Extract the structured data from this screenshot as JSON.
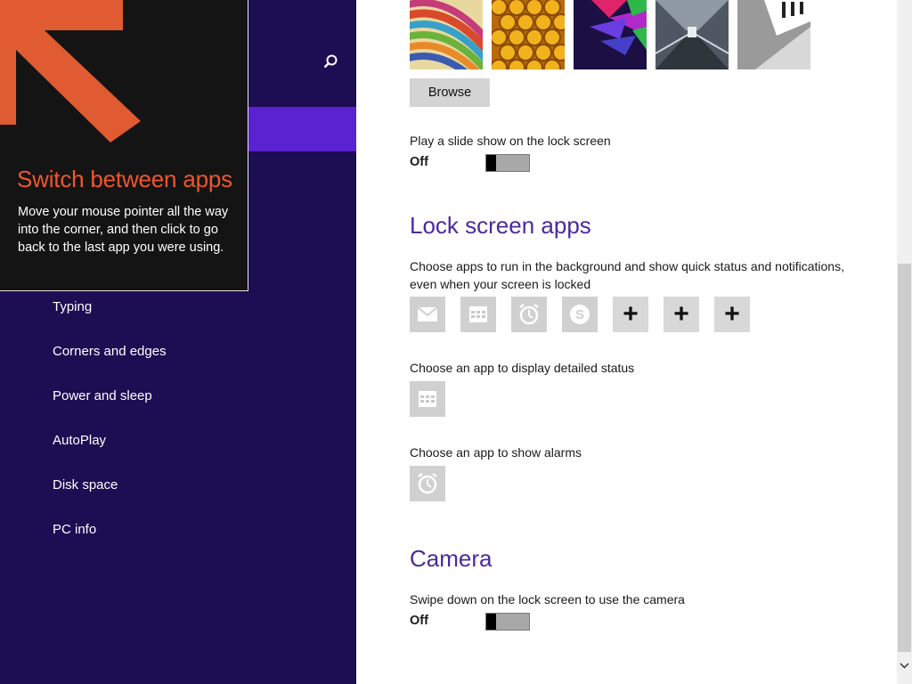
{
  "tip": {
    "title": "Switch between apps",
    "body": "Move your mouse pointer all the way into the corner, and then click to go back to the last app you were using."
  },
  "nav": {
    "search_icon": "search-icon",
    "items": [
      {
        "label": "Typing"
      },
      {
        "label": "Corners and edges"
      },
      {
        "label": "Power and sleep"
      },
      {
        "label": "AutoPlay"
      },
      {
        "label": "Disk space"
      },
      {
        "label": "PC info"
      }
    ]
  },
  "lock_screen": {
    "browse_label": "Browse",
    "slideshow_label": "Play a slide show on the lock screen",
    "slideshow_state": "Off"
  },
  "lock_apps": {
    "heading": "Lock screen apps",
    "description": "Choose apps to run in the background and show quick status and notifications, even when your screen is locked",
    "slots": [
      {
        "icon": "mail-icon"
      },
      {
        "icon": "calendar-icon"
      },
      {
        "icon": "alarm-icon"
      },
      {
        "icon": "skype-icon"
      },
      {
        "icon": "plus",
        "glyph": "+"
      },
      {
        "icon": "plus",
        "glyph": "+"
      },
      {
        "icon": "plus",
        "glyph": "+"
      }
    ],
    "detailed_status_label": "Choose an app to display detailed status",
    "alarms_label": "Choose an app to show alarms"
  },
  "camera": {
    "heading": "Camera",
    "swipe_label": "Swipe down on the lock screen to use the camera",
    "swipe_state": "Off"
  },
  "colors": {
    "nav_bg": "#1d0d52",
    "nav_selected": "#5b22d1",
    "accent_heading": "#4b2a9b",
    "tip_title": "#f0562a"
  }
}
